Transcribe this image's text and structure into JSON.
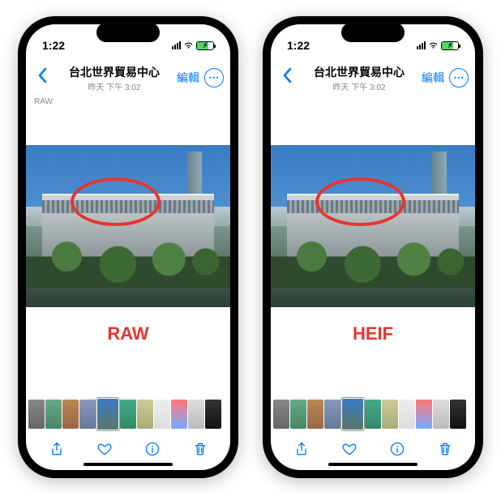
{
  "phones": [
    {
      "status": {
        "time": "1:22"
      },
      "nav": {
        "title": "台北世界貿易中心",
        "subtitle": "昨天 下午 3:02",
        "edit_label": "編輯"
      },
      "raw_badge": "RAW",
      "format_label": "RAW"
    },
    {
      "status": {
        "time": "1:22"
      },
      "nav": {
        "title": "台北世界貿易中心",
        "subtitle": "昨天 下午 3:02",
        "edit_label": "編輯"
      },
      "raw_badge": "",
      "format_label": "HEIF"
    }
  ],
  "icons": {
    "back": "chevron-left",
    "more": "ellipsis-circle",
    "share": "share",
    "favorite": "heart",
    "info": "info-circle",
    "trash": "trash"
  },
  "colors": {
    "accent": "#007aff",
    "annotation_red": "#e53530"
  }
}
